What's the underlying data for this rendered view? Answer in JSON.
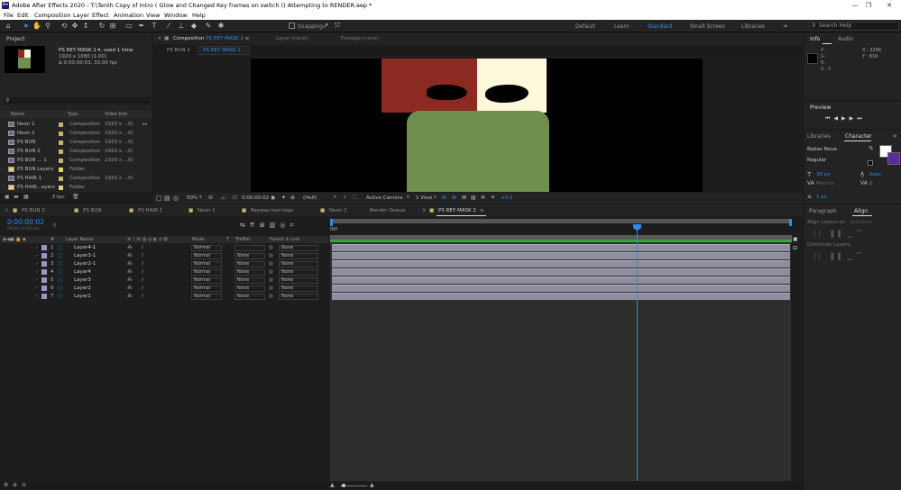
{
  "window": {
    "app_logo": "Ae",
    "title": "Adobe After Effects 2020 - T:\\Tenth Copy of Intro ( Glow and Changed Key frames on switch () Attempting to RENDER.aep *",
    "minimize": "—",
    "maximize": "❐",
    "close": "✕"
  },
  "menu": [
    "File",
    "Edit",
    "Composition",
    "Layer",
    "Effect",
    "Animation",
    "View",
    "Window",
    "Help"
  ],
  "toolbar": {
    "snapping_label": "Snapping",
    "workspaces": [
      "Default",
      "Learn",
      "Standard",
      "Small Screen",
      "Libraries"
    ],
    "active_workspace": "Standard",
    "search_placeholder": "Search Help"
  },
  "project": {
    "panel_title": "Project",
    "selected_name": "PS REY MASK 2 ▾",
    "used_text": ", used 1 time",
    "dims": "1920 x 1080 (1.00)",
    "duration": "Δ 0:00:00:03, 30.00 fps",
    "bpc": "8 bpc",
    "columns": {
      "name": "Name",
      "type": "Type",
      "video_info": "Video Info"
    },
    "items": [
      {
        "name": "Neon 1",
        "type": "Composition",
        "info": "1920 x ...0)",
        "color": "#c8b46a",
        "folder": false
      },
      {
        "name": "Neon 2",
        "type": "Composition",
        "info": "1920 x ...0)",
        "color": "#c8b46a",
        "folder": false
      },
      {
        "name": "PS BUN",
        "type": "Composition",
        "info": "1920 x ...0)",
        "color": "#c8b46a",
        "folder": false
      },
      {
        "name": "PS BUN 2",
        "type": "Composition",
        "info": "1920 x ...0)",
        "color": "#c8b46a",
        "folder": false
      },
      {
        "name": "PS BUN ... 1",
        "type": "Composition",
        "info": "1920 x ...0)",
        "color": "#c8b46a",
        "folder": false
      },
      {
        "name": "PS BUN Layers",
        "type": "Folder",
        "info": "",
        "color": "#e8d36a",
        "folder": true
      },
      {
        "name": "PS HAIR 1",
        "type": "Composition",
        "info": "1920 x ...0)",
        "color": "#c8b46a",
        "folder": false
      },
      {
        "name": "PS HAIR...ayers",
        "type": "Folder",
        "info": "",
        "color": "#e8d36a",
        "folder": true
      }
    ]
  },
  "comp_viewer": {
    "tab_label": "Composition",
    "tab_comp": "PS REY MASK 2",
    "layer_tab": "Layer (none)",
    "footage_tab": "Footage (none)",
    "breadcrumbs": [
      "PS BUN 2",
      "PS REY MASK 2"
    ],
    "zoom": "50%",
    "timecode": "0:00:00:02",
    "resolution": "(Half)",
    "camera": "Active Camera",
    "views": "1 View",
    "exposure": "+0.0"
  },
  "info_panel": {
    "tabs": [
      "Info",
      "Audio"
    ],
    "rgba_labels": [
      "R :",
      "G :",
      "B :",
      "A : 0"
    ],
    "x": "X : 3296",
    "y": "Y : 616"
  },
  "preview_panel": {
    "title": "Preview"
  },
  "libraries_panel": {
    "tabs": [
      "Libraries",
      "Character"
    ]
  },
  "character_panel": {
    "font": "Bebas Neue",
    "style": "Regular",
    "size": "36 px",
    "leading": "Auto",
    "kerning": "Metrics",
    "tracking": "0",
    "stroke": "1 px",
    "colors": {
      "fill": "#ffffff",
      "stroke": "#5a2a9e"
    }
  },
  "align_panel": {
    "tabs": [
      "Paragraph",
      "Align"
    ],
    "align_to_label": "Align Layers to:",
    "align_to_value": "Selection",
    "distribute_label": "Distribute Layers:"
  },
  "timeline": {
    "tabs": [
      "PS BUN 2",
      "PS BUN",
      "PS HAIR 1",
      "Neon 1",
      "Reywas text logo",
      "Neon 2",
      "Render Queue",
      "PS REY MASK 2"
    ],
    "active_tab": "PS REY MASK 2",
    "timecode": "0:00:00:02",
    "frame_sub": "00002 (30.00 fps)",
    "search_placeholder": "",
    "ruler_start": "00f",
    "columns": {
      "num": "#",
      "layer_name": "Layer Name",
      "mode": "Mode",
      "t": "T",
      "trkmat": "TrkMat",
      "parent": "Parent & Link"
    },
    "layers": [
      {
        "num": "1",
        "name": "Layer4-1",
        "mode": "Normal",
        "trkmat": "",
        "parent": "None",
        "color": "#9a94c8"
      },
      {
        "num": "2",
        "name": "Layer3-1",
        "mode": "Normal",
        "trkmat": "None",
        "parent": "None",
        "color": "#9a94c8"
      },
      {
        "num": "3",
        "name": "Layer2-1",
        "mode": "Normal",
        "trkmat": "None",
        "parent": "None",
        "color": "#9a94c8"
      },
      {
        "num": "4",
        "name": "Layer4",
        "mode": "Normal",
        "trkmat": "None",
        "parent": "None",
        "color": "#9a94c8"
      },
      {
        "num": "5",
        "name": "Layer3",
        "mode": "Normal",
        "trkmat": "None",
        "parent": "None",
        "color": "#9a94c8"
      },
      {
        "num": "6",
        "name": "Layer2",
        "mode": "Normal",
        "trkmat": "None",
        "parent": "None",
        "color": "#9a94c8"
      },
      {
        "num": "7",
        "name": "Layer1",
        "mode": "Normal",
        "trkmat": "None",
        "parent": "None",
        "color": "#9a94c8"
      }
    ]
  },
  "artwork": {
    "red": "#8b2a22",
    "cream": "#fdf8dc",
    "green": "#6f8f4e",
    "black": "#000000"
  }
}
